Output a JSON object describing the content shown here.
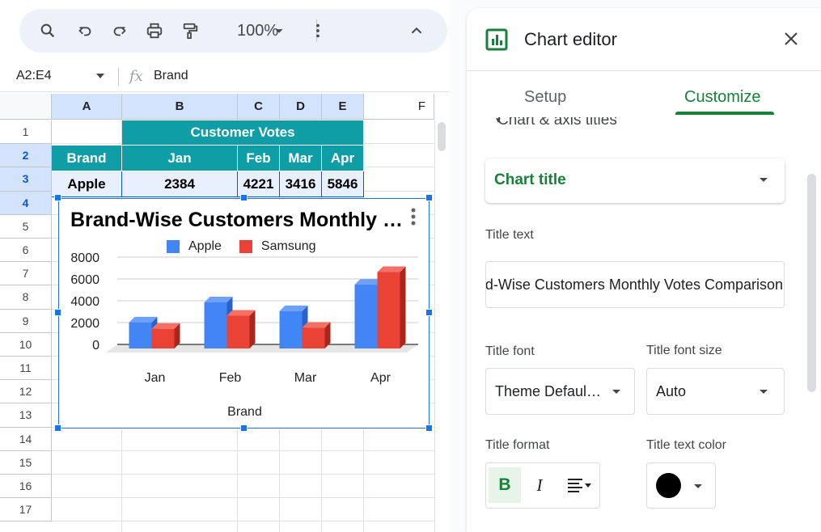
{
  "toolbar": {
    "zoom": "100%",
    "icons": [
      "search-icon",
      "undo-icon",
      "redo-icon",
      "print-icon",
      "paint-format-icon",
      "chevron-down-icon",
      "more-vert-icon",
      "chevron-up-icon"
    ]
  },
  "formula_bar": {
    "name_box": "A2:E4",
    "fx": "fx",
    "value": "Brand"
  },
  "sheet": {
    "columns": [
      "A",
      "B",
      "C",
      "D",
      "E",
      "F"
    ],
    "rows": [
      "1",
      "2",
      "3",
      "4",
      "5",
      "6",
      "7",
      "8",
      "9",
      "10",
      "11",
      "12",
      "13",
      "14",
      "15",
      "16",
      "17"
    ],
    "merged_title": "Customer Votes",
    "header_row": [
      "Brand",
      "Jan",
      "Feb",
      "Mar",
      "Apr"
    ],
    "row3": [
      "Apple",
      "2384",
      "4221",
      "3416",
      "5846"
    ]
  },
  "chart": {
    "title": "Brand-Wise Customers Monthly Votes Comparison",
    "xlabel": "Brand"
  },
  "chart_data": {
    "type": "bar",
    "title": "Brand-Wise Customers Monthly Votes Comparison",
    "xlabel": "Brand",
    "ylabel": "",
    "categories": [
      "Jan",
      "Feb",
      "Mar",
      "Apr"
    ],
    "series": [
      {
        "name": "Apple",
        "color": "#4285f4",
        "values": [
          2384,
          4221,
          3416,
          5846
        ]
      },
      {
        "name": "Samsung",
        "color": "#ea4335",
        "values": [
          1800,
          3000,
          1900,
          7000
        ]
      }
    ],
    "yticks": [
      "8000",
      "6000",
      "4000",
      "2000",
      "0"
    ],
    "ylim": [
      0,
      8000
    ],
    "grid": true,
    "legend": "top",
    "style": "3d"
  },
  "panel": {
    "title": "Chart editor",
    "tabs": [
      "Setup",
      "Customize"
    ],
    "active_tab": "Customize",
    "section_peek": "Chart & axis titles",
    "title_dropdown": "Chart title",
    "title_text_label": "Title text",
    "title_text_value": "Brand-Wise Customers Monthly Votes Comparison",
    "title_font_label": "Title font",
    "title_font_value": "Theme Defaul…",
    "title_font_size_label": "Title font size",
    "title_font_size_value": "Auto",
    "title_format_label": "Title format",
    "title_text_color_label": "Title text color",
    "bold": "B",
    "italic": "I",
    "title_color": "#000000",
    "accent": "#188038"
  }
}
